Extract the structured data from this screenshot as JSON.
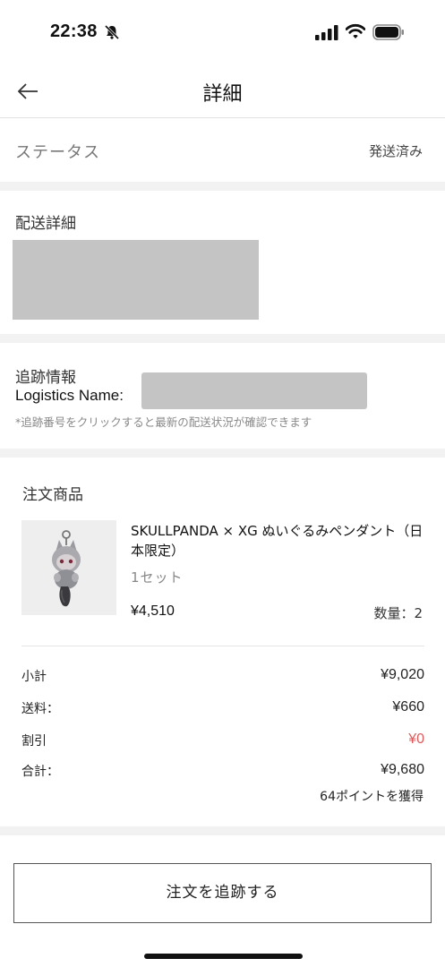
{
  "status_bar": {
    "time": "22:38"
  },
  "nav": {
    "title": "詳細"
  },
  "status_row": {
    "label": "ステータス",
    "value": "発送済み"
  },
  "delivery": {
    "title": "配送詳細"
  },
  "tracking": {
    "title": "追跡情報",
    "logistics_label": "Logistics Name:",
    "hint": "*追跡番号をクリックすると最新の配送状況が確認できます"
  },
  "order": {
    "title": "注文商品",
    "product": {
      "name": "SKULLPANDA × XG ぬいぐるみペンダント（日本限定）",
      "variant": "1セット",
      "price": "¥4,510",
      "quantity": "数量：2"
    },
    "summary": [
      {
        "label": "小計",
        "value": "¥9,020"
      },
      {
        "label": "送料：",
        "value": "¥660"
      },
      {
        "label": "割引",
        "value": "¥0"
      },
      {
        "label": "合計：",
        "value": "¥9,680"
      }
    ],
    "points": "64ポイントを獲得"
  },
  "track_button": {
    "label": "注文を追跡する"
  },
  "colors": {
    "discount": "#e05a5a",
    "gap": "#f2f2f2",
    "redaction": "#c4c4c4"
  }
}
